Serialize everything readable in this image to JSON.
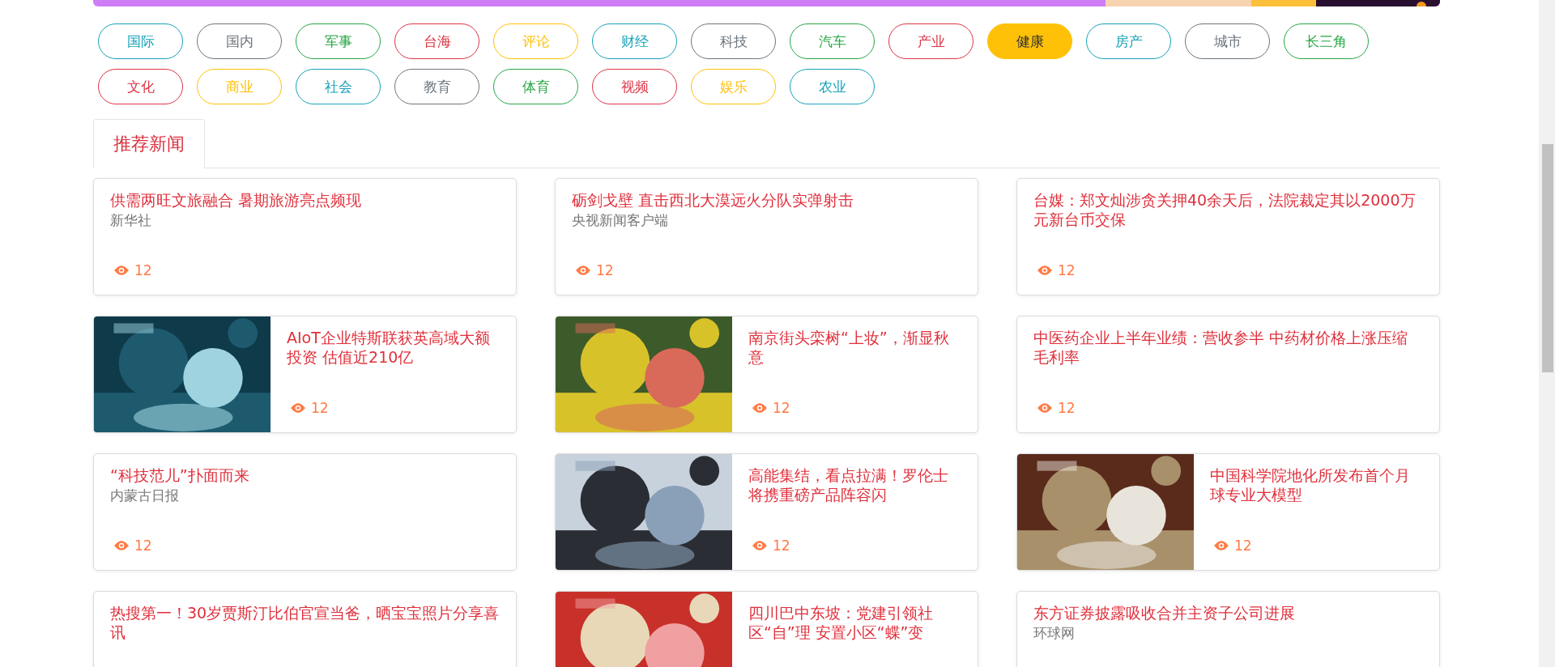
{
  "categories": [
    {
      "label": "国际",
      "color": "#17a2b8",
      "selected": false
    },
    {
      "label": "国内",
      "color": "#6c757d",
      "selected": false
    },
    {
      "label": "军事",
      "color": "#28a745",
      "selected": false
    },
    {
      "label": "台海",
      "color": "#dc3545",
      "selected": false
    },
    {
      "label": "评论",
      "color": "#ffc107",
      "selected": false
    },
    {
      "label": "财经",
      "color": "#17a2b8",
      "selected": false
    },
    {
      "label": "科技",
      "color": "#6c757d",
      "selected": false
    },
    {
      "label": "汽车",
      "color": "#28a745",
      "selected": false
    },
    {
      "label": "产业",
      "color": "#dc3545",
      "selected": false
    },
    {
      "label": "健康",
      "color": "#ffc107",
      "selected": true
    },
    {
      "label": "房产",
      "color": "#17a2b8",
      "selected": false
    },
    {
      "label": "城市",
      "color": "#6c757d",
      "selected": false
    },
    {
      "label": "长三角",
      "color": "#28a745",
      "selected": false
    },
    {
      "label": "文化",
      "color": "#dc3545",
      "selected": false
    },
    {
      "label": "商业",
      "color": "#ffc107",
      "selected": false
    },
    {
      "label": "社会",
      "color": "#17a2b8",
      "selected": false
    },
    {
      "label": "教育",
      "color": "#6c757d",
      "selected": false
    },
    {
      "label": "体育",
      "color": "#28a745",
      "selected": false
    },
    {
      "label": "视频",
      "color": "#dc3545",
      "selected": false
    },
    {
      "label": "娱乐",
      "color": "#ffc107",
      "selected": false
    },
    {
      "label": "农业",
      "color": "#17a2b8",
      "selected": false
    }
  ],
  "tabs": [
    {
      "label": "推荐新闻",
      "selected": true
    }
  ],
  "news": [
    {
      "kind": "text",
      "title": "供需两旺文旅融合 暑期旅游亮点频现",
      "source": "新华社",
      "views": "12"
    },
    {
      "kind": "text",
      "title": "砺剑戈壁 直击西北大漠远火分队实弹射击",
      "source": "央视新闻客户端",
      "views": "12"
    },
    {
      "kind": "text",
      "title": "台媒：郑文灿涉贪关押40余天后，法院裁定其以2000万元新台币交保",
      "views": "12"
    },
    {
      "title": "AIoT企业特斯联获英高域大额投资 估值近210亿",
      "views": "12"
    },
    {
      "title": "南京街头栾树“上妆”，渐显秋意",
      "views": "12"
    },
    {
      "kind": "text",
      "title": "中医药企业上半年业绩：营收参半 中药材价格上涨压缩毛利率",
      "views": "12"
    },
    {
      "kind": "text",
      "title": "“科技范儿”扑面而来",
      "source": "内蒙古日报",
      "views": "12"
    },
    {
      "title": "高能集结，看点拉满！罗伦士将携重磅产品阵容闪",
      "views": "12"
    },
    {
      "title": "中国科学院地化所发布首个月球专业大模型",
      "views": "12"
    },
    {
      "kind": "text",
      "title": "热搜第一！30岁贾斯汀比伯官宣当爸，晒宝宝照片分享喜讯"
    },
    {
      "title": "四川巴中东坡：党建引领社区“自”理 安置小区“蝶”变"
    },
    {
      "kind": "text",
      "title": "东方证券披露吸收合并主资子公司进展",
      "source": "环球网"
    }
  ]
}
